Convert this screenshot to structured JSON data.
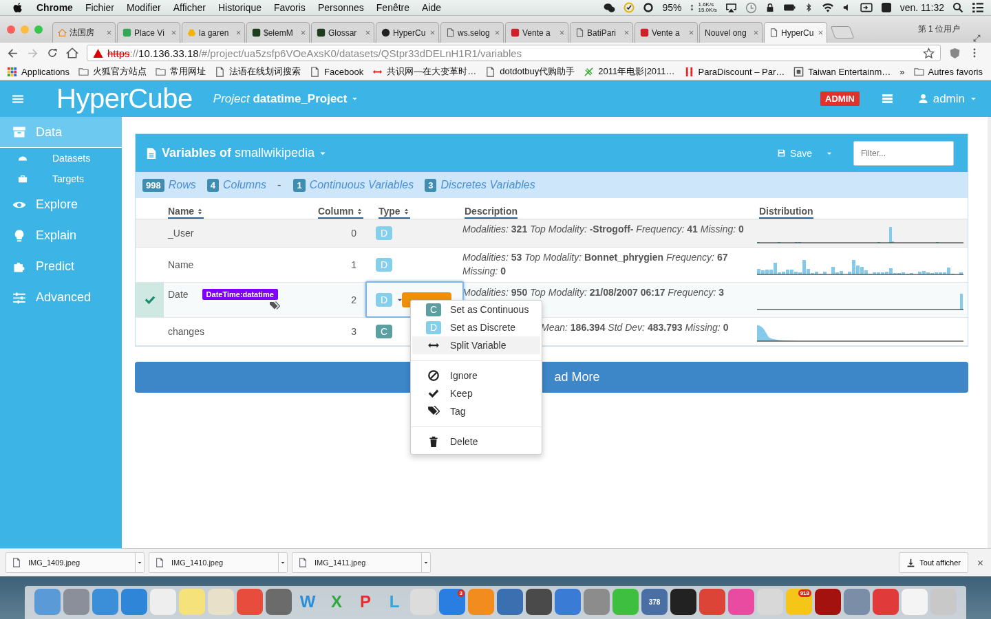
{
  "menubar": {
    "app": "Chrome",
    "menus": [
      "Fichier",
      "Modifier",
      "Afficher",
      "Historique",
      "Favoris",
      "Personnes",
      "Fenêtre",
      "Aide"
    ],
    "battery": "95%",
    "upload": "1.6K/s",
    "download": "15.0K/s",
    "clock": "ven. 11:32"
  },
  "tabs": [
    {
      "title": "法国房",
      "selected": false
    },
    {
      "title": "Place Vi",
      "selected": false
    },
    {
      "title": "la garen",
      "selected": false
    },
    {
      "title": "$elemM",
      "selected": false
    },
    {
      "title": "Glossar",
      "selected": false
    },
    {
      "title": "HyperCu",
      "selected": false
    },
    {
      "title": "ws.selog",
      "selected": false
    },
    {
      "title": "Vente a",
      "selected": false
    },
    {
      "title": "BatiPari",
      "selected": false
    },
    {
      "title": "Vente a",
      "selected": false
    },
    {
      "title": "Nouvel ong",
      "selected": false
    },
    {
      "title": "HyperCu",
      "selected": true
    }
  ],
  "profile": "第 1 位用户",
  "address": {
    "scheme": "https",
    "separator": "://",
    "host": "10.136.33.18",
    "path": "/#/project/ua5zsfp6VOeAxsK0/datasets/QStpr33dDELnH1R1/variables"
  },
  "bookmarks": [
    "Applications",
    "火狐官方站点",
    "常用网址",
    "法语在线划词搜索",
    "Facebook",
    "共识网—在大变革时…",
    "dotdotbuy代购助手",
    "2011年电影|2011…",
    "ParaDiscount – Par…",
    "Taiwan Entertainm…"
  ],
  "bookmarks_more": "»",
  "other_bookmarks": "Autres favoris",
  "app": {
    "logo": "HyperCube",
    "project": "*Project* **datatime_Project**",
    "role": "ADMIN",
    "user": "admin"
  },
  "sidebar": [
    {
      "label": "Data",
      "selected": true,
      "children": [
        {
          "label": "Datasets",
          "selected": false
        },
        {
          "label": "Targets",
          "selected": false
        }
      ]
    },
    {
      "label": "Explore",
      "selected": false
    },
    {
      "label": "Explain",
      "selected": false
    },
    {
      "label": "Predict",
      "selected": false
    },
    {
      "label": "Advanced",
      "selected": false
    }
  ],
  "panel": {
    "title": "**Variables of** smallwikipedia",
    "save": "Save",
    "filter_placeholder": "Filter..."
  },
  "stats": [
    {
      "kind": "count",
      "count": "998",
      "label": "Rows"
    },
    {
      "kind": "count",
      "count": "4",
      "label": "Columns"
    },
    {
      "kind": "separator",
      "label": "-"
    },
    {
      "kind": "count",
      "count": "1",
      "label": "Continuous Variables"
    },
    {
      "kind": "count",
      "count": "3",
      "label": "Discretes Variables"
    }
  ],
  "table": {
    "columns": [
      {
        "label": "Name",
        "sortable": true
      },
      {
        "label": "Column",
        "sortable": true
      },
      {
        "label": "Type",
        "sortable": true
      },
      {
        "label": "Description",
        "sortable": false
      },
      {
        "label": "Distribution",
        "sortable": false
      }
    ],
    "rows": [
      {
        "kind": "discrete",
        "selected": false,
        "name": "_User",
        "column": "0",
        "type": "D",
        "menu_open": false,
        "description": "Modalities: **321** Top Modality: **-Strogoff-** Frequency: **41** Missing: **0**"
      },
      {
        "kind": "discrete",
        "selected": false,
        "name": "Name",
        "column": "1",
        "type": "D",
        "menu_open": false,
        "description": "Modalities: **53** Top Modality: **Bonnet_phrygien** Frequency: **67** Missing: **0**"
      },
      {
        "kind": "discrete",
        "selected": true,
        "name": "Date",
        "tag": "DateTime:datatime",
        "column": "2",
        "type": "D",
        "menu_open": true,
        "description": "Modalities: **950** Top Modality: **21/08/2007 06:17** Frequency: **3**"
      },
      {
        "kind": "continuous",
        "selected": false,
        "name": "changes",
        "column": "3",
        "type": "C",
        "menu_open": false,
        "description": "Mean: **186.394** Std Dev: **483.793** Missing: **0**"
      }
    ]
  },
  "load_more": "ad More",
  "type_menu": [
    [
      {
        "kind": "continuous",
        "badge": "C",
        "label": "Set as Continuous",
        "selected": false
      },
      {
        "kind": "discrete",
        "badge": "D",
        "label": "Set as Discrete",
        "selected": false
      },
      {
        "kind": "split",
        "label": "Split Variable",
        "selected": true
      }
    ],
    [
      {
        "kind": "ignore",
        "label": "Ignore",
        "selected": false
      },
      {
        "kind": "keep",
        "label": "Keep",
        "selected": false
      },
      {
        "kind": "tag",
        "label": "Tag",
        "selected": false
      }
    ],
    [
      {
        "kind": "delete",
        "label": "Delete",
        "selected": false
      }
    ]
  ],
  "downloads": [
    {
      "file": "IMG_1409.jpeg"
    },
    {
      "file": "IMG_1410.jpeg"
    },
    {
      "file": "IMG_1411.jpeg"
    }
  ],
  "show_all": "Tout afficher",
  "dock": [
    {
      "color": "#5a9ad6"
    },
    {
      "color": "#8a8f99"
    },
    {
      "color": "#3b8fd8"
    },
    {
      "color": "#2f86d8"
    },
    {
      "color": "#eeeeee"
    },
    {
      "color": "#f5e27a"
    },
    {
      "color": "#e8e0c8"
    },
    {
      "color": "#e74c3c"
    },
    {
      "color": "#6b6b6b"
    },
    {
      "color": "#2a8fd6",
      "letter": "W"
    },
    {
      "color": "#2eaa3c",
      "letter": "X"
    },
    {
      "color": "#e0322b",
      "letter": "P"
    },
    {
      "color": "#2fa6d8",
      "letter": "L"
    },
    {
      "color": "#dcdcdc"
    },
    {
      "color": "#2a7de1",
      "badge": "3"
    },
    {
      "color": "#f28c1e"
    },
    {
      "color": "#3a6fb0"
    },
    {
      "color": "#4a4a4a"
    },
    {
      "color": "#3a7bd5"
    },
    {
      "color": "#8c8c8c"
    },
    {
      "color": "#3fbf3f"
    },
    {
      "color": "#4a6fa5",
      "text": "378"
    },
    {
      "color": "#222222"
    },
    {
      "color": "#db4437"
    },
    {
      "color": "#e84b9f"
    },
    {
      "color": "#d8d8d8"
    },
    {
      "color": "#f5c518",
      "badge": "918"
    },
    {
      "color": "#a3120f"
    },
    {
      "color": "#7a8ea8"
    },
    {
      "color": "#e03a3a"
    },
    {
      "color": "#f4f4f4"
    },
    {
      "color": "#c8c8c8"
    }
  ]
}
